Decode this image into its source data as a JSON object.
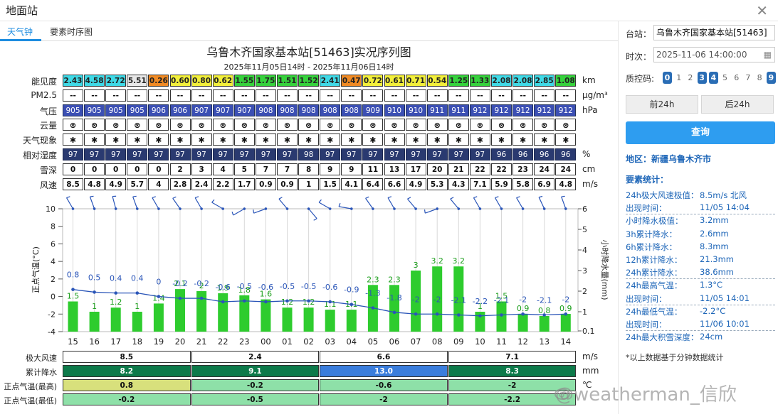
{
  "window": {
    "title": "地面站"
  },
  "tabs": [
    {
      "label": "天气钟",
      "active": true
    },
    {
      "label": "要素时序图",
      "active": false
    }
  ],
  "chart_title": "乌鲁木齐国家基本站[51463]实况序列图",
  "chart_subtitle": "2025年11月05日14时 - 2025年11月06日14时",
  "row_labels": {
    "vis": "能见度",
    "pm": "PM2.5",
    "pres": "气压",
    "cloud": "云量",
    "wx": "天气现象",
    "rh": "相对湿度",
    "snow": "雪深",
    "wind": "风速"
  },
  "units": {
    "vis": "km",
    "pm": "μg/m³",
    "pres": "hPa",
    "rh": "%",
    "snow": "cm",
    "wind": "m/s"
  },
  "hours": [
    "15",
    "16",
    "17",
    "18",
    "19",
    "20",
    "21",
    "22",
    "23",
    "00",
    "01",
    "02",
    "03",
    "04",
    "05",
    "06",
    "07",
    "08",
    "09",
    "10",
    "11",
    "12",
    "13",
    "14"
  ],
  "vis": [
    "2.43",
    "4.58",
    "2.72",
    "5.51",
    "0.26",
    "0.60",
    "0.80",
    "0.62",
    "1.55",
    "1.75",
    "1.51",
    "1.52",
    "2.41",
    "0.47",
    "0.72",
    "0.61",
    "0.71",
    "0.54",
    "1.25",
    "1.33",
    "2.08",
    "2.08",
    "2.85",
    "1.08"
  ],
  "vis_colors": [
    "#3fd9e6",
    "#3fd9e6",
    "#3fd9e6",
    "#e8e8e8",
    "#f08a24",
    "#f2ef3a",
    "#f2ef3a",
    "#f2ef3a",
    "#36d23c",
    "#36d23c",
    "#36d23c",
    "#36d23c",
    "#3fd9e6",
    "#f08a24",
    "#f2ef3a",
    "#f2ef3a",
    "#f2ef3a",
    "#f2ef3a",
    "#36d23c",
    "#36d23c",
    "#3fd9e6",
    "#3fd9e6",
    "#3fd9e6",
    "#36d23c"
  ],
  "pm": [
    "--",
    "--",
    "--",
    "--",
    "--",
    "--",
    "--",
    "--",
    "--",
    "--",
    "--",
    "--",
    "--",
    "--",
    "--",
    "--",
    "--",
    "--",
    "--",
    "--",
    "--",
    "--",
    "--",
    "--"
  ],
  "pres": [
    "905",
    "905",
    "905",
    "905",
    "906",
    "906",
    "907",
    "907",
    "907",
    "908",
    "908",
    "908",
    "908",
    "908",
    "909",
    "910",
    "910",
    "911",
    "911",
    "912",
    "912",
    "912",
    "912",
    "912"
  ],
  "cloud_icon": "⊗",
  "wx_icon": "✱",
  "rh": [
    "97",
    "97",
    "97",
    "97",
    "97",
    "97",
    "97",
    "97",
    "97",
    "97",
    "97",
    "98",
    "97",
    "97",
    "97",
    "97",
    "97",
    "97",
    "97",
    "97",
    "96",
    "96",
    "96",
    "96"
  ],
  "snow": [
    "0",
    "0",
    "0",
    "0",
    "0",
    "2",
    "3",
    "4",
    "5",
    "7",
    "7",
    "8",
    "9",
    "9",
    "11",
    "13",
    "17",
    "20",
    "21",
    "22",
    "22",
    "23",
    "24",
    "24"
  ],
  "wind": [
    "8.5",
    "4.8",
    "4.9",
    "5.7",
    "4",
    "2.8",
    "2.4",
    "2.2",
    "1.7",
    "0.9",
    "0.9",
    "1",
    "1.5",
    "4.1",
    "6.4",
    "6.6",
    "4.9",
    "5.3",
    "4.3",
    "7.1",
    "5.9",
    "5.8",
    "6.9",
    "4.8"
  ],
  "left_axis": {
    "label": "正点气温(°C)",
    "ticks": [
      "10",
      "8",
      "6",
      "4",
      "2",
      "0",
      "-2",
      "-4"
    ]
  },
  "right_axis": {
    "label": "小时降水量(mm)",
    "ticks": [
      "6",
      "5",
      "4",
      "3",
      "2",
      "1",
      "0.1"
    ]
  },
  "chart_data": {
    "type": "bar",
    "categories": [
      "15",
      "16",
      "17",
      "18",
      "19",
      "20",
      "21",
      "22",
      "23",
      "00",
      "01",
      "02",
      "03",
      "04",
      "05",
      "06",
      "07",
      "08",
      "09",
      "10",
      "11",
      "12",
      "13",
      "14"
    ],
    "series": [
      {
        "name": "",
        "type": "bar",
        "values": [
          1.5,
          1,
          1.2,
          1,
          1.4,
          2.1,
          2,
          1.9,
          1.8,
          1.6,
          1.2,
          1.2,
          1.1,
          1.1,
          2.3,
          2.3,
          3,
          3.2,
          3.2,
          1,
          1.5,
          0.9,
          0.8,
          0.9
        ],
        "color": "#2ecc2e"
      },
      {
        "name": "",
        "type": "line",
        "values": [
          0.8,
          0.5,
          0.4,
          0.4,
          0,
          -0.2,
          -0.2,
          -0.6,
          -0.5,
          -0.6,
          -0.5,
          -0.5,
          -0.6,
          -0.9,
          -1.3,
          -1.8,
          -2,
          -2,
          -2.1,
          -2.2,
          -2.1,
          -2,
          -2.1,
          -2
        ],
        "color": "#2a55b8"
      }
    ],
    "left_range": [
      -4,
      10
    ],
    "right_range": [
      0.1,
      6
    ],
    "right_ticks": [
      6,
      5,
      4,
      3,
      2,
      1,
      0.1
    ],
    "left_ticks": [
      10,
      8,
      6,
      4,
      2,
      0,
      -2,
      -4
    ]
  },
  "wind_barbs_visible": true,
  "summary": {
    "labels": [
      "极大风速",
      "累计降水",
      "正点气温(最高)",
      "正点气温(最低)"
    ],
    "units": [
      "m/s",
      "mm",
      "℃",
      ""
    ],
    "rows": [
      {
        "values": [
          "8.5",
          "2.4",
          "6.6",
          "7.1"
        ],
        "colors": [
          "#ffffff",
          "#ffffff",
          "#ffffff",
          "#ffffff"
        ]
      },
      {
        "values": [
          "8.2",
          "9.1",
          "13.0",
          "8.3"
        ],
        "colors": [
          "#0d7a4a",
          "#0d7a4a",
          "#3a7ddc",
          "#0d7a4a"
        ]
      },
      {
        "values": [
          "0.8",
          "-0.2",
          "-0.6",
          "-2"
        ],
        "colors": [
          "#d8e07c",
          "#8ee0a8",
          "#8ee0a8",
          "#8ee0a8"
        ]
      },
      {
        "values": [
          "-0.2",
          "-0.5",
          "-2",
          "-2.2"
        ],
        "colors": [
          "#8ee0a8",
          "#8ee0a8",
          "#8ee0a8",
          "#8ee0a8"
        ]
      }
    ]
  },
  "sidebar": {
    "station_label": "台站：",
    "station_value": "乌鲁木齐国家基本站[51463]",
    "time_label": "时次：",
    "time_value": "2025-11-06 14:00:00",
    "qc_label": "质控码:",
    "qc_codes": [
      {
        "code": "0",
        "on": true
      },
      {
        "code": "1",
        "on": false
      },
      {
        "code": "2",
        "on": false
      },
      {
        "code": "3",
        "on": true
      },
      {
        "code": "4",
        "on": true
      },
      {
        "code": "5",
        "on": false
      },
      {
        "code": "6",
        "on": false
      },
      {
        "code": "7",
        "on": false
      },
      {
        "code": "8",
        "on": false
      },
      {
        "code": "9",
        "on": true
      }
    ],
    "prev_label": "前24h",
    "next_label": "后24h",
    "query_label": "查询",
    "region": "地区：新疆乌鲁木齐市",
    "stats_heading": "要素统计：",
    "stats": [
      {
        "k": "24h极大风速极值：",
        "v": "8.5m/s 北风"
      },
      {
        "k": "出现时间：",
        "v": "11/05 14:04"
      },
      {
        "k": "小时降水极值：",
        "v": "3.2mm"
      },
      {
        "k": "3h累计降水：",
        "v": "2.6mm"
      },
      {
        "k": "6h累计降水：",
        "v": "8.3mm"
      },
      {
        "k": "12h累计降水：",
        "v": "21.3mm"
      },
      {
        "k": "24h累计降水：",
        "v": "38.6mm"
      },
      {
        "k": "24h最高气温：",
        "v": "1.3°C"
      },
      {
        "k": "出现时间：",
        "v": "11/05 14:01"
      },
      {
        "k": "24h最低气温：",
        "v": "-2.2°C"
      },
      {
        "k": "出现时间：",
        "v": "11/06 10:01"
      },
      {
        "k": "24h最大积雪深度：",
        "v": "24cm"
      }
    ],
    "note": "*以上数据基于分钟数据统计"
  },
  "watermark": "@weatherman_信欣"
}
